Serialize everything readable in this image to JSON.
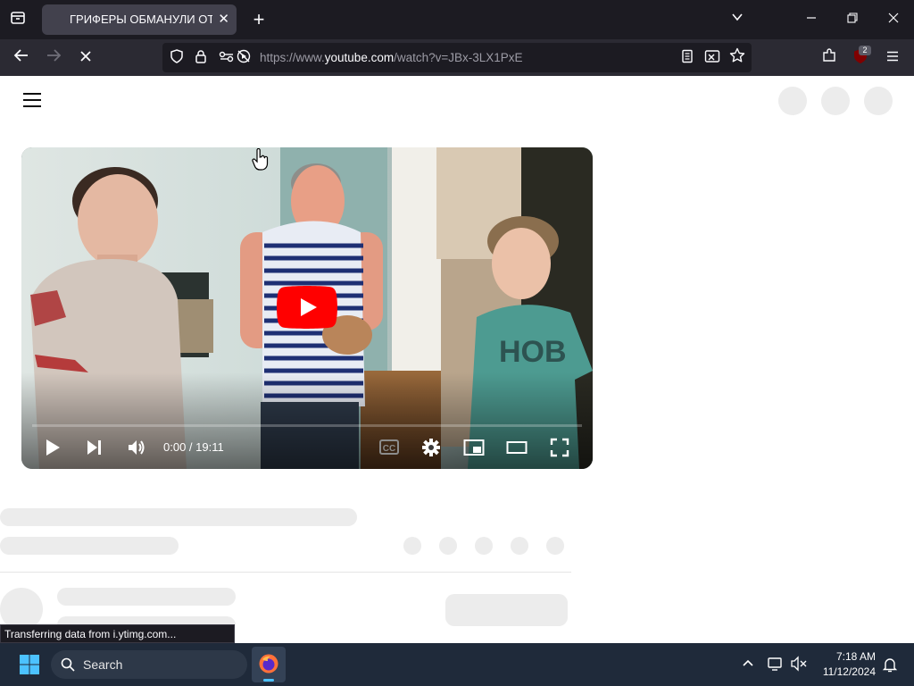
{
  "browser": {
    "tab_title": "ГРИФЕРЫ ОБМАНУЛИ ОТЦА",
    "url_prefix": "https://www.",
    "url_host": "youtube.com",
    "url_path": "/watch?v=JBx-3LX1PxE",
    "extension_badge": "2",
    "status_text": "Transferring data from i.ytimg.com..."
  },
  "video": {
    "time": "0:00 / 19:11",
    "progress": 0,
    "cc_label": "CC"
  },
  "taskbar": {
    "search_placeholder": "Search",
    "time": "7:18 AM",
    "date": "11/12/2024"
  },
  "colors": {
    "tab_bg": "#42414d",
    "toolbar_bg": "#2b2a33",
    "youtube_red": "#ff0000",
    "skeleton": "#ececec",
    "taskbar_bg": "#1f2a3a"
  }
}
